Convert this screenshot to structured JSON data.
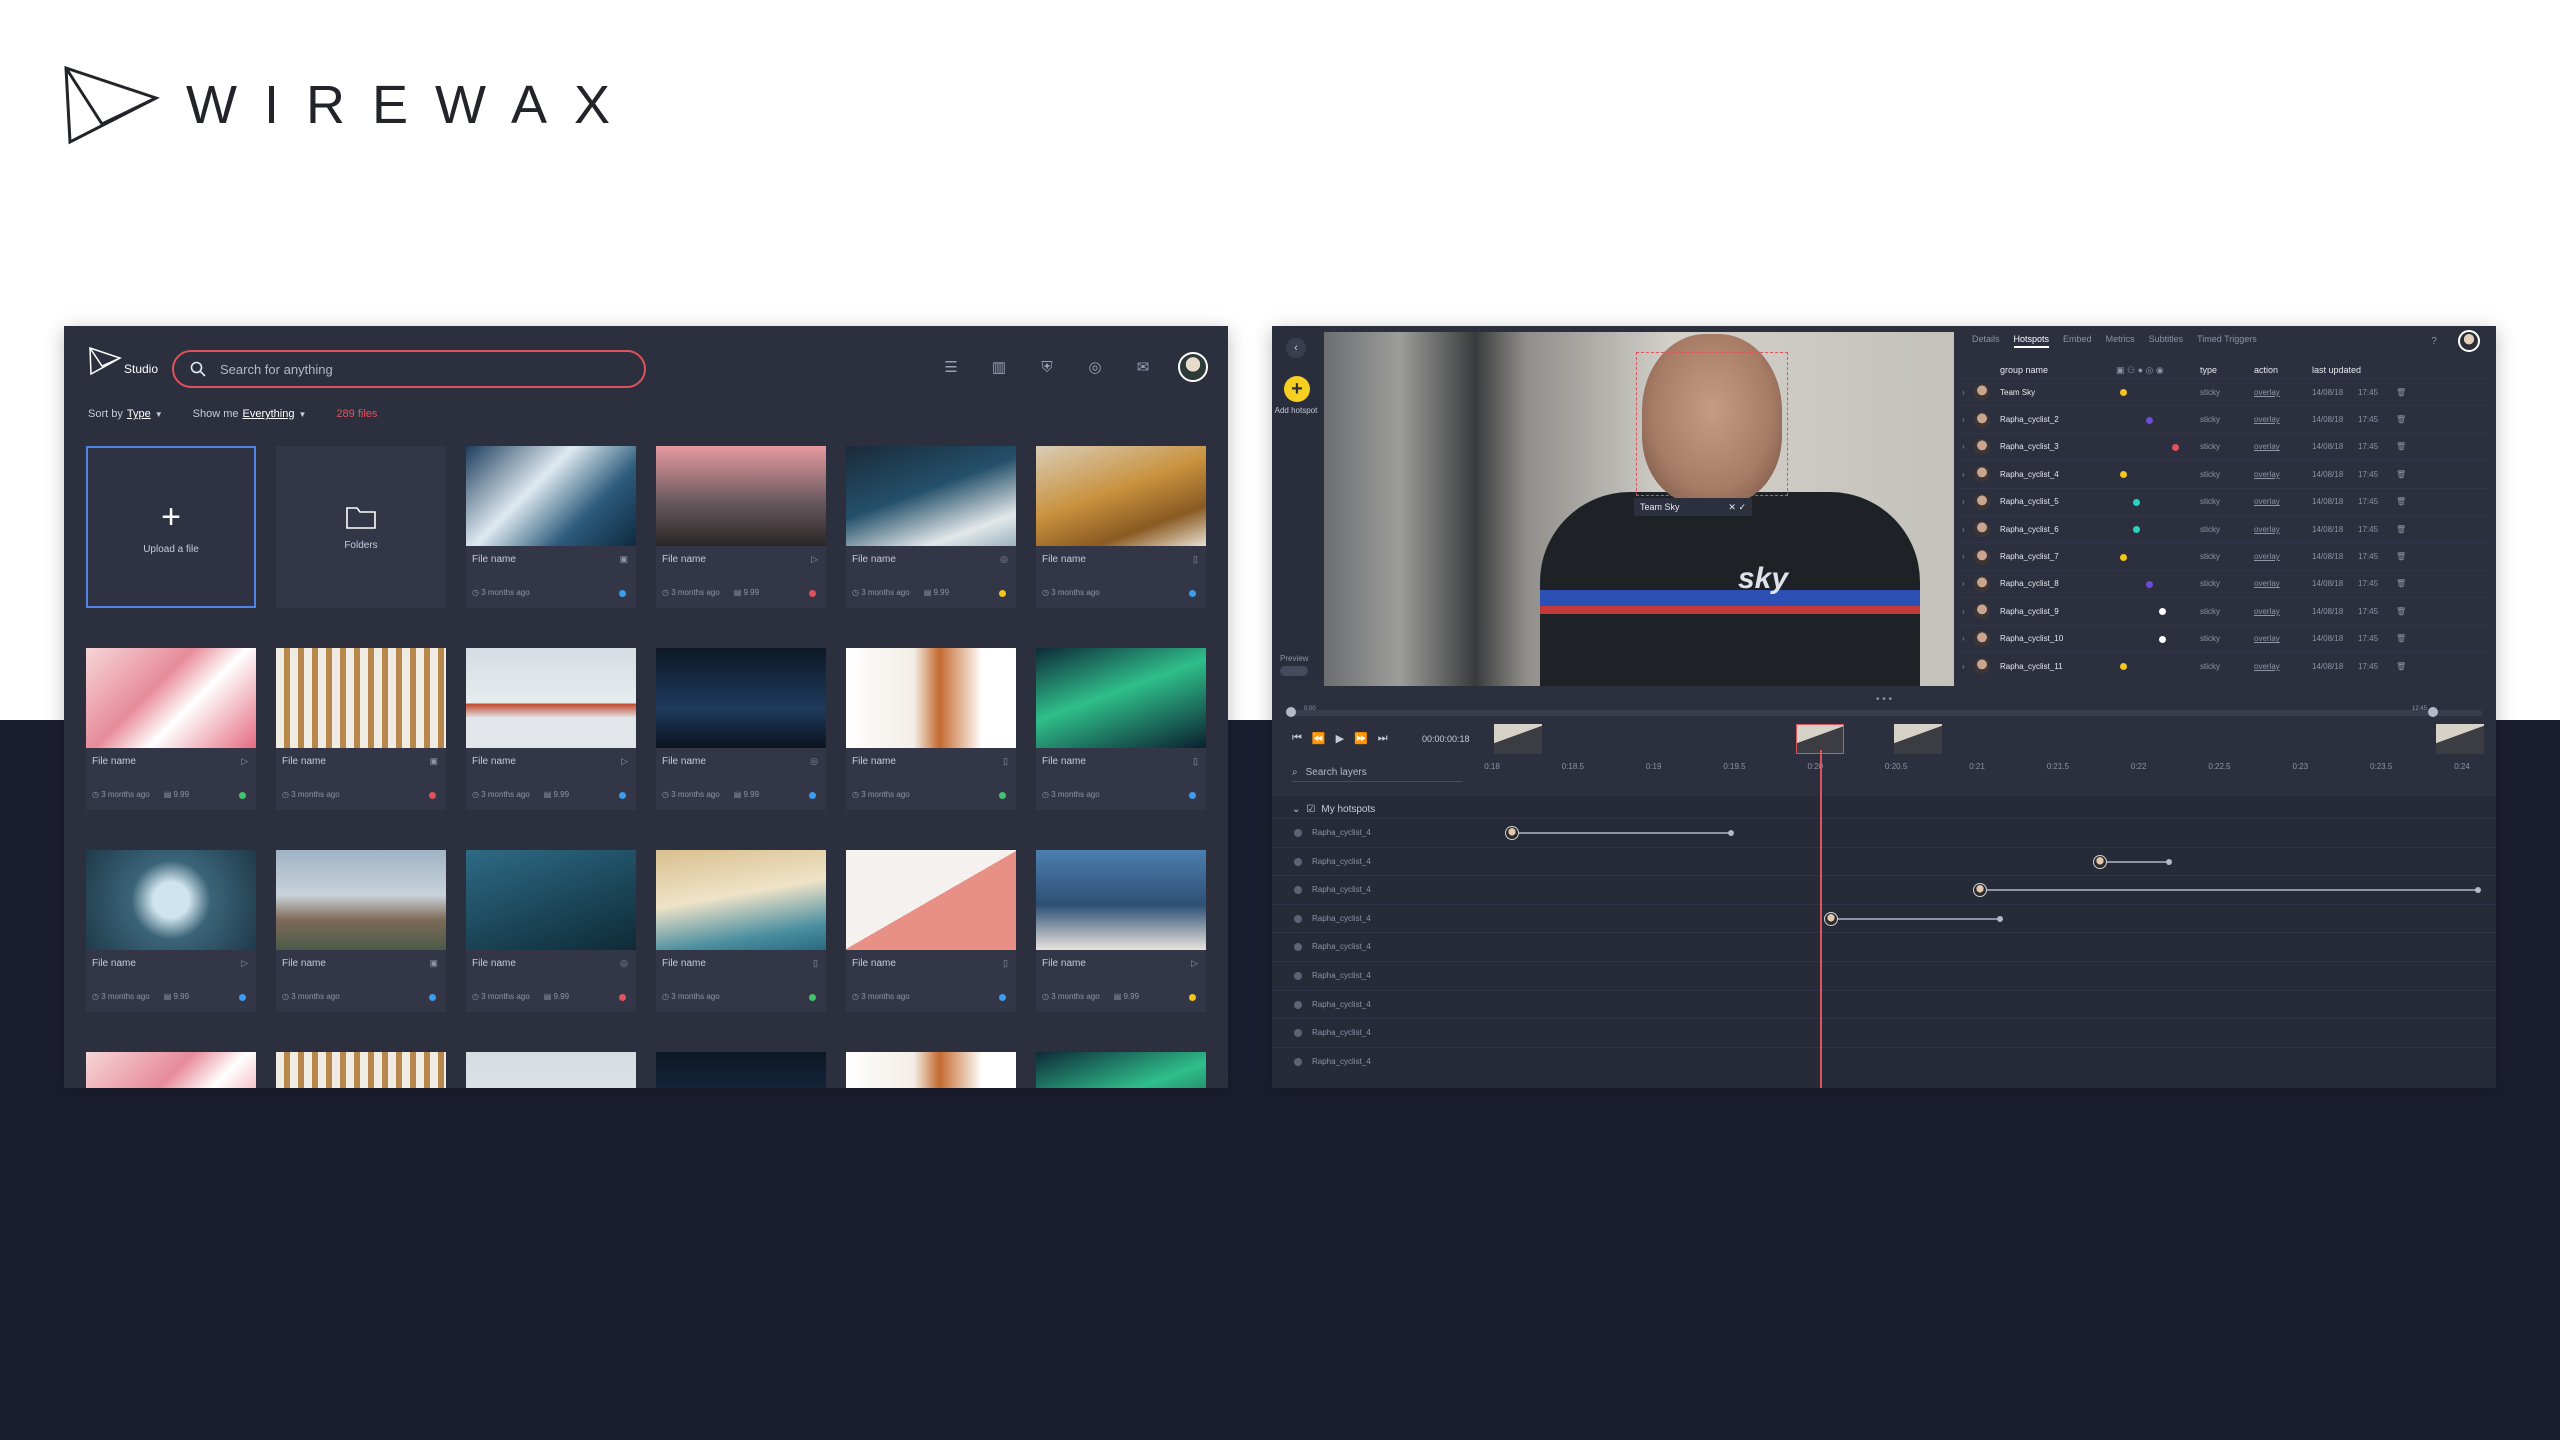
{
  "brand": {
    "wordmark": "WIREWAX"
  },
  "studio": {
    "logo_text": "Studio",
    "search_placeholder": "Search for anything",
    "top_icons": [
      "list-icon",
      "bar-chart-icon",
      "shield-icon",
      "globe-icon",
      "mail-icon"
    ],
    "sort_by_label": "Sort by",
    "sort_by_value": "Type",
    "show_me_label": "Show me",
    "show_me_value": "Everything",
    "files_count": "289 files",
    "upload_label": "Upload a file",
    "folders_label": "Folders",
    "cards": [
      {
        "name": "File name",
        "type_icon": "image-icon",
        "age": "3 months ago",
        "size": "",
        "dot": "#3b9cf0",
        "thumb": "linear-gradient(135deg,#1d3d5c 0%,#dfeaf1 40%,#2d5c7c 70%,#0f2a40 100%)"
      },
      {
        "name": "File name",
        "type_icon": "play-icon",
        "age": "3 months ago",
        "size": "9.99",
        "dot": "#e0525c",
        "thumb": "linear-gradient(180deg,#e79aa0 0%,#6a5a60 55%,#2a2626 100%)"
      },
      {
        "name": "File name",
        "type_icon": "audio-icon",
        "age": "3 months ago",
        "size": "9.99",
        "dot": "#f5c518",
        "thumb": "linear-gradient(160deg,#1a2a3a 0%,#24506a 45%,#e3e8ea 80%,#9ab3bf 100%)"
      },
      {
        "name": "File name",
        "type_icon": "doc-icon",
        "age": "3 months ago",
        "size": "",
        "dot": "#3b9cf0",
        "thumb": "linear-gradient(160deg,#d9cdb6 0%,#c9923f 45%,#8a5a22 75%,#e8e0d0 100%)"
      },
      {
        "name": "File name",
        "type_icon": "play-icon",
        "age": "3 months ago",
        "size": "9.99",
        "dot": "#41c46b",
        "thumb": "linear-gradient(135deg,#f6d5d8 0%,#e78b99 40%,#ffffff 60%,#e56a80 100%)"
      },
      {
        "name": "File name",
        "type_icon": "image-icon",
        "age": "3 months ago",
        "size": "",
        "dot": "#e0525c",
        "thumb": "repeating-linear-gradient(90deg,#f1ece3 0 8px,#b8874c 8px 14px)"
      },
      {
        "name": "File name",
        "type_icon": "play-icon",
        "age": "3 months ago",
        "size": "9.99",
        "dot": "#3b9cf0",
        "thumb": "linear-gradient(180deg,#d5dce2 0%,#e7ecef 55%,#c24a2e 56%,#e2e6ea 70%)"
      },
      {
        "name": "File name",
        "type_icon": "audio-icon",
        "age": "3 months ago",
        "size": "9.99",
        "dot": "#3b9cf0",
        "thumb": "linear-gradient(180deg,#0d1826 0%,#1e3a5c 60%,#0b1420 100%)"
      },
      {
        "name": "File name",
        "type_icon": "doc-icon",
        "age": "3 months ago",
        "size": "",
        "dot": "#41c46b",
        "thumb": "linear-gradient(90deg,#ffffff 0%,#f3ede6 40%,#c46a2e 55%,#ffffff 80%)"
      },
      {
        "name": "File name",
        "type_icon": "doc-icon",
        "age": "3 months ago",
        "size": "",
        "dot": "#3b9cf0",
        "thumb": "linear-gradient(160deg,#0e2a38 0%,#2fbf8a 45%,#0b2030 100%)"
      },
      {
        "name": "File name",
        "type_icon": "play-icon",
        "age": "3 months ago",
        "size": "9.99",
        "dot": "#3b9cf0",
        "thumb": "radial-gradient(circle at 50% 50%,#cfe4ee 0 18%,#3b6478 40%,#1f3a4a 100%)"
      },
      {
        "name": "File name",
        "type_icon": "image-icon",
        "age": "3 months ago",
        "size": "",
        "dot": "#3b9cf0",
        "thumb": "linear-gradient(180deg,#9fb3c4 0%,#c9d3da 45%,#7d6a58 70%,#4c5a48 100%)"
      },
      {
        "name": "File name",
        "type_icon": "audio-icon",
        "age": "3 months ago",
        "size": "9.99",
        "dot": "#e0525c",
        "thumb": "linear-gradient(160deg,#2e6b85 0%,#1a4456 60%,#0f2a36 100%)"
      },
      {
        "name": "File name",
        "type_icon": "doc-icon",
        "age": "3 months ago",
        "size": "",
        "dot": "#41c46b",
        "thumb": "linear-gradient(170deg,#d9bf8e 0%,#efe3c8 45%,#4b8fa0 80%,#2a6a80 100%)"
      },
      {
        "name": "File name",
        "type_icon": "doc-icon",
        "age": "3 months ago",
        "size": "",
        "dot": "#3b9cf0",
        "thumb": "linear-gradient(150deg,#f4f1ee 0 50%,#e88f86 50% 100%)"
      },
      {
        "name": "File name",
        "type_icon": "play-icon",
        "age": "3 months ago",
        "size": "9.99",
        "dot": "#f5c518",
        "thumb": "linear-gradient(180deg,#4b7fb0 0%,#2e4f74 55%,#e8e4df 100%)"
      },
      {
        "name": "",
        "type_icon": "",
        "age": "",
        "size": "",
        "dot": "",
        "thumb": "linear-gradient(135deg,#f6d5d8 0%,#e78b99 40%,#ffffff 60%,#e56a80 100%)"
      },
      {
        "name": "",
        "type_icon": "",
        "age": "",
        "size": "",
        "dot": "",
        "thumb": "repeating-linear-gradient(90deg,#f1ece3 0 8px,#b8874c 8px 14px)"
      },
      {
        "name": "",
        "type_icon": "",
        "age": "",
        "size": "",
        "dot": "",
        "thumb": "linear-gradient(180deg,#d5dce2 0%,#e7ecef 100%)"
      },
      {
        "name": "",
        "type_icon": "",
        "age": "",
        "size": "",
        "dot": "",
        "thumb": "linear-gradient(180deg,#0d1826 0%,#1e3a5c 100%)"
      },
      {
        "name": "",
        "type_icon": "",
        "age": "",
        "size": "",
        "dot": "",
        "thumb": "linear-gradient(90deg,#ffffff 0%,#f3ede6 40%,#c46a2e 55%,#ffffff 80%)"
      },
      {
        "name": "",
        "type_icon": "",
        "age": "",
        "size": "",
        "dot": "",
        "thumb": "linear-gradient(160deg,#0e2a38 0%,#2fbf8a 45%,#0b2030 100%)"
      }
    ]
  },
  "editor": {
    "add_hotspot_label": "Add hotspot",
    "preview_label": "Preview",
    "hotspot_tag": "Team Sky",
    "video_logo": "sky",
    "tabs": [
      "Details",
      "Hotspots",
      "Embed",
      "Metrics",
      "Subtitles",
      "Timed Triggers"
    ],
    "active_tab": "Hotspots",
    "table": {
      "col_group": "group name",
      "col_type": "type",
      "col_action": "action",
      "col_updated": "last updated",
      "rows": [
        {
          "name": "Team Sky",
          "mark": "#f5c518",
          "col": 0,
          "type": "sticky",
          "action": "overlay",
          "date": "14/08/18",
          "time": "17:45"
        },
        {
          "name": "Rapha_cyclist_2",
          "mark": "#6b4bd8",
          "col": 2,
          "type": "sticky",
          "action": "overlay",
          "date": "14/08/18",
          "time": "17:45"
        },
        {
          "name": "Rapha_cyclist_3",
          "mark": "#e0525c",
          "col": 4,
          "type": "sticky",
          "action": "overlay",
          "date": "14/08/18",
          "time": "17:45"
        },
        {
          "name": "Rapha_cyclist_4",
          "mark": "#f5c518",
          "col": 0,
          "type": "sticky",
          "action": "overlay",
          "date": "14/08/18",
          "time": "17:45"
        },
        {
          "name": "Rapha_cyclist_5",
          "mark": "#29d3c0",
          "col": 1,
          "type": "sticky",
          "action": "overlay",
          "date": "14/08/18",
          "time": "17:45"
        },
        {
          "name": "Rapha_cyclist_6",
          "mark": "#29d3c0",
          "col": 1,
          "type": "sticky",
          "action": "overlay",
          "date": "14/08/18",
          "time": "17:45"
        },
        {
          "name": "Rapha_cyclist_7",
          "mark": "#f5c518",
          "col": 0,
          "type": "sticky",
          "action": "overlay",
          "date": "14/08/18",
          "time": "17:45"
        },
        {
          "name": "Rapha_cyclist_8",
          "mark": "#6b4bd8",
          "col": 2,
          "type": "sticky",
          "action": "overlay",
          "date": "14/08/18",
          "time": "17:45"
        },
        {
          "name": "Rapha_cyclist_9",
          "mark": "#ffffff",
          "col": 3,
          "type": "sticky",
          "action": "overlay",
          "date": "14/08/18",
          "time": "17:45"
        },
        {
          "name": "Rapha_cyclist_10",
          "mark": "#ffffff",
          "col": 3,
          "type": "sticky",
          "action": "overlay",
          "date": "14/08/18",
          "time": "17:45"
        },
        {
          "name": "Rapha_cyclist_11",
          "mark": "#f5c518",
          "col": 0,
          "type": "sticky",
          "action": "overlay",
          "date": "14/08/18",
          "time": "17:45"
        }
      ]
    },
    "timecode": "00:00:00:18",
    "scrub_start": "0:00",
    "scrub_end": "12:45",
    "search_layers_placeholder": "Search layers",
    "ruler_ticks": [
      "0:18",
      "0:18.5",
      "0:19",
      "0:19.5",
      "0:20",
      "0:20.5",
      "0:21",
      "0:21.5",
      "0:22",
      "0:22.5",
      "0:23",
      "0:23.5",
      "0:24"
    ],
    "group_name": "My hotspots",
    "layers": [
      {
        "name": "Rapha_cyclist_4",
        "start": 0.02,
        "end": 0.24
      },
      {
        "name": "Rapha_cyclist_4",
        "start": 0.61,
        "end": 0.68
      },
      {
        "name": "Rapha_cyclist_4",
        "start": 0.49,
        "end": 0.99
      },
      {
        "name": "Rapha_cyclist_4",
        "start": 0.34,
        "end": 0.51
      },
      {
        "name": "Rapha_cyclist_4",
        "start": null,
        "end": null
      },
      {
        "name": "Rapha_cyclist_4",
        "start": null,
        "end": null
      },
      {
        "name": "Rapha_cyclist_4",
        "start": null,
        "end": null
      },
      {
        "name": "Rapha_cyclist_4",
        "start": null,
        "end": null
      },
      {
        "name": "Rapha_cyclist_4",
        "start": null,
        "end": null
      }
    ]
  },
  "colors": {
    "accent_red": "#e0525c",
    "accent_blue": "#4d84e6",
    "accent_yellow": "#f5d020",
    "dark_band": "#1b1e30"
  }
}
